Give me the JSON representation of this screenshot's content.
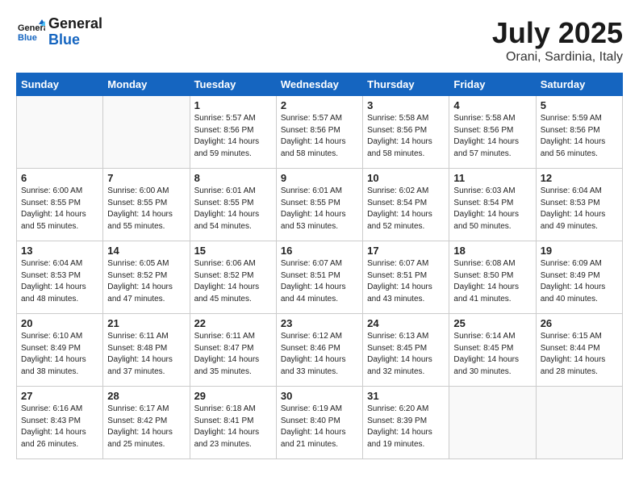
{
  "header": {
    "logo_general": "General",
    "logo_blue": "Blue",
    "month": "July 2025",
    "location": "Orani, Sardinia, Italy"
  },
  "days_of_week": [
    "Sunday",
    "Monday",
    "Tuesday",
    "Wednesday",
    "Thursday",
    "Friday",
    "Saturday"
  ],
  "weeks": [
    [
      {
        "day": "",
        "info": ""
      },
      {
        "day": "",
        "info": ""
      },
      {
        "day": "1",
        "info": "Sunrise: 5:57 AM\nSunset: 8:56 PM\nDaylight: 14 hours\nand 59 minutes."
      },
      {
        "day": "2",
        "info": "Sunrise: 5:57 AM\nSunset: 8:56 PM\nDaylight: 14 hours\nand 58 minutes."
      },
      {
        "day": "3",
        "info": "Sunrise: 5:58 AM\nSunset: 8:56 PM\nDaylight: 14 hours\nand 58 minutes."
      },
      {
        "day": "4",
        "info": "Sunrise: 5:58 AM\nSunset: 8:56 PM\nDaylight: 14 hours\nand 57 minutes."
      },
      {
        "day": "5",
        "info": "Sunrise: 5:59 AM\nSunset: 8:56 PM\nDaylight: 14 hours\nand 56 minutes."
      }
    ],
    [
      {
        "day": "6",
        "info": "Sunrise: 6:00 AM\nSunset: 8:55 PM\nDaylight: 14 hours\nand 55 minutes."
      },
      {
        "day": "7",
        "info": "Sunrise: 6:00 AM\nSunset: 8:55 PM\nDaylight: 14 hours\nand 55 minutes."
      },
      {
        "day": "8",
        "info": "Sunrise: 6:01 AM\nSunset: 8:55 PM\nDaylight: 14 hours\nand 54 minutes."
      },
      {
        "day": "9",
        "info": "Sunrise: 6:01 AM\nSunset: 8:55 PM\nDaylight: 14 hours\nand 53 minutes."
      },
      {
        "day": "10",
        "info": "Sunrise: 6:02 AM\nSunset: 8:54 PM\nDaylight: 14 hours\nand 52 minutes."
      },
      {
        "day": "11",
        "info": "Sunrise: 6:03 AM\nSunset: 8:54 PM\nDaylight: 14 hours\nand 50 minutes."
      },
      {
        "day": "12",
        "info": "Sunrise: 6:04 AM\nSunset: 8:53 PM\nDaylight: 14 hours\nand 49 minutes."
      }
    ],
    [
      {
        "day": "13",
        "info": "Sunrise: 6:04 AM\nSunset: 8:53 PM\nDaylight: 14 hours\nand 48 minutes."
      },
      {
        "day": "14",
        "info": "Sunrise: 6:05 AM\nSunset: 8:52 PM\nDaylight: 14 hours\nand 47 minutes."
      },
      {
        "day": "15",
        "info": "Sunrise: 6:06 AM\nSunset: 8:52 PM\nDaylight: 14 hours\nand 45 minutes."
      },
      {
        "day": "16",
        "info": "Sunrise: 6:07 AM\nSunset: 8:51 PM\nDaylight: 14 hours\nand 44 minutes."
      },
      {
        "day": "17",
        "info": "Sunrise: 6:07 AM\nSunset: 8:51 PM\nDaylight: 14 hours\nand 43 minutes."
      },
      {
        "day": "18",
        "info": "Sunrise: 6:08 AM\nSunset: 8:50 PM\nDaylight: 14 hours\nand 41 minutes."
      },
      {
        "day": "19",
        "info": "Sunrise: 6:09 AM\nSunset: 8:49 PM\nDaylight: 14 hours\nand 40 minutes."
      }
    ],
    [
      {
        "day": "20",
        "info": "Sunrise: 6:10 AM\nSunset: 8:49 PM\nDaylight: 14 hours\nand 38 minutes."
      },
      {
        "day": "21",
        "info": "Sunrise: 6:11 AM\nSunset: 8:48 PM\nDaylight: 14 hours\nand 37 minutes."
      },
      {
        "day": "22",
        "info": "Sunrise: 6:11 AM\nSunset: 8:47 PM\nDaylight: 14 hours\nand 35 minutes."
      },
      {
        "day": "23",
        "info": "Sunrise: 6:12 AM\nSunset: 8:46 PM\nDaylight: 14 hours\nand 33 minutes."
      },
      {
        "day": "24",
        "info": "Sunrise: 6:13 AM\nSunset: 8:45 PM\nDaylight: 14 hours\nand 32 minutes."
      },
      {
        "day": "25",
        "info": "Sunrise: 6:14 AM\nSunset: 8:45 PM\nDaylight: 14 hours\nand 30 minutes."
      },
      {
        "day": "26",
        "info": "Sunrise: 6:15 AM\nSunset: 8:44 PM\nDaylight: 14 hours\nand 28 minutes."
      }
    ],
    [
      {
        "day": "27",
        "info": "Sunrise: 6:16 AM\nSunset: 8:43 PM\nDaylight: 14 hours\nand 26 minutes."
      },
      {
        "day": "28",
        "info": "Sunrise: 6:17 AM\nSunset: 8:42 PM\nDaylight: 14 hours\nand 25 minutes."
      },
      {
        "day": "29",
        "info": "Sunrise: 6:18 AM\nSunset: 8:41 PM\nDaylight: 14 hours\nand 23 minutes."
      },
      {
        "day": "30",
        "info": "Sunrise: 6:19 AM\nSunset: 8:40 PM\nDaylight: 14 hours\nand 21 minutes."
      },
      {
        "day": "31",
        "info": "Sunrise: 6:20 AM\nSunset: 8:39 PM\nDaylight: 14 hours\nand 19 minutes."
      },
      {
        "day": "",
        "info": ""
      },
      {
        "day": "",
        "info": ""
      }
    ]
  ]
}
